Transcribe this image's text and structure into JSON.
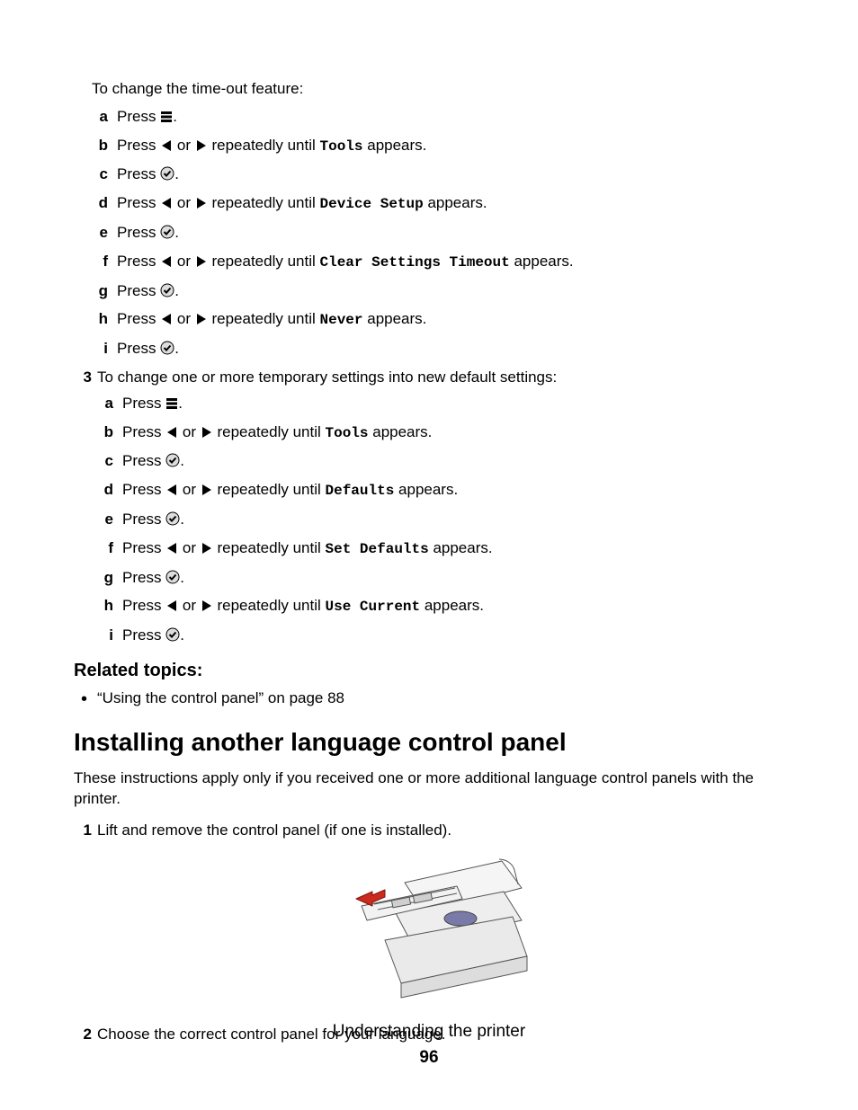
{
  "intro": "To change the time-out feature:",
  "listA": {
    "a": {
      "press": "Press ",
      "tail": "."
    },
    "b": {
      "press": "Press ",
      "or": " or ",
      "mid": " repeatedly until ",
      "mono": "Tools",
      "tail": " appears."
    },
    "c": {
      "press": "Press ",
      "tail": "."
    },
    "d": {
      "press": "Press ",
      "or": " or ",
      "mid": " repeatedly until ",
      "mono": "Device Setup",
      "tail": " appears."
    },
    "e": {
      "press": "Press ",
      "tail": "."
    },
    "f": {
      "press": "Press ",
      "or": " or ",
      "mid": " repeatedly until ",
      "mono": "Clear Settings Timeout",
      "tail": " appears."
    },
    "g": {
      "press": "Press ",
      "tail": "."
    },
    "h": {
      "press": "Press ",
      "or": " or ",
      "mid": " repeatedly until ",
      "mono": "Never",
      "tail": " appears."
    },
    "i": {
      "press": "Press ",
      "tail": "."
    }
  },
  "step3": "To change one or more temporary settings into new default settings:",
  "listB": {
    "a": {
      "press": "Press ",
      "tail": "."
    },
    "b": {
      "press": "Press ",
      "or": " or ",
      "mid": " repeatedly until ",
      "mono": "Tools",
      "tail": " appears."
    },
    "c": {
      "press": "Press ",
      "tail": "."
    },
    "d": {
      "press": "Press ",
      "or": " or ",
      "mid": " repeatedly until ",
      "mono": "Defaults",
      "tail": " appears."
    },
    "e": {
      "press": "Press ",
      "tail": "."
    },
    "f": {
      "press": "Press ",
      "or": " or ",
      "mid": " repeatedly until ",
      "mono": "Set Defaults",
      "tail": " appears."
    },
    "g": {
      "press": "Press ",
      "tail": "."
    },
    "h": {
      "press": "Press ",
      "or": " or ",
      "mid": " repeatedly until ",
      "mono": "Use Current",
      "tail": " appears."
    },
    "i": {
      "press": "Press ",
      "tail": "."
    }
  },
  "related_heading": "Related topics:",
  "related_item": "“Using the control panel” on page 88",
  "h2": "Installing another language control panel",
  "h2_para": "These instructions apply only if you received one or more additional language control panels with the printer.",
  "step1": "Lift and remove the control panel (if one is installed).",
  "step2": "Choose the correct control panel for your language.",
  "markers": {
    "n3": "3",
    "n1": "1",
    "n2": "2",
    "a": "a",
    "b": "b",
    "c": "c",
    "d": "d",
    "e": "e",
    "f": "f",
    "g": "g",
    "h": "h",
    "i": "i"
  },
  "footer": {
    "title": "Understanding the printer",
    "page": "96"
  }
}
